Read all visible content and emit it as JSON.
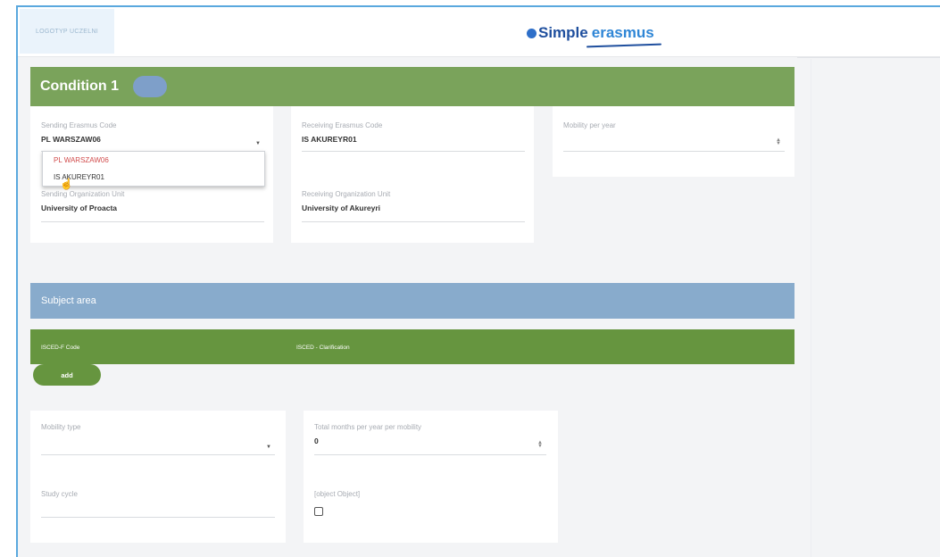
{
  "header": {
    "logo_placeholder": "LOGOTYP UCZELNI",
    "brand_simple": "Simple",
    "brand_erasmus": "erasmus"
  },
  "condition": {
    "title": "Condition 1"
  },
  "sending_code": {
    "label": "Sending Erasmus Code",
    "value": "PL WARSZAW06",
    "options": [
      "PL WARSZAW06",
      "IS AKUREYR01"
    ]
  },
  "receiving_code": {
    "label": "Receiving Erasmus Code",
    "value": "IS AKUREYR01"
  },
  "mobility_per_year": {
    "label": "Mobility per year",
    "value": ""
  },
  "sending_unit": {
    "label": "Sending Organization Unit",
    "value": "University of Proacta"
  },
  "receiving_unit": {
    "label": "Receiving Organization Unit",
    "value": "University of Akureyri"
  },
  "subject_area": {
    "title": "Subject area",
    "col_code": "ISCED-F Code",
    "col_clarification": "ISCED - Clarification",
    "add_label": "add"
  },
  "mobility_type": {
    "label": "Mobility type",
    "value": ""
  },
  "total_months": {
    "label": "Total months per year per mobility",
    "value": "0"
  },
  "study_cycle": {
    "label": "Study cycle",
    "value": ""
  },
  "object_field": {
    "label": "[object Object]",
    "checked": false
  },
  "colors": {
    "green_bar": "#7aa35b",
    "dark_green": "#66953f",
    "blue_bar": "#88abcc",
    "toggle": "#7e9fc9",
    "selected_option": "#d14b4b"
  }
}
